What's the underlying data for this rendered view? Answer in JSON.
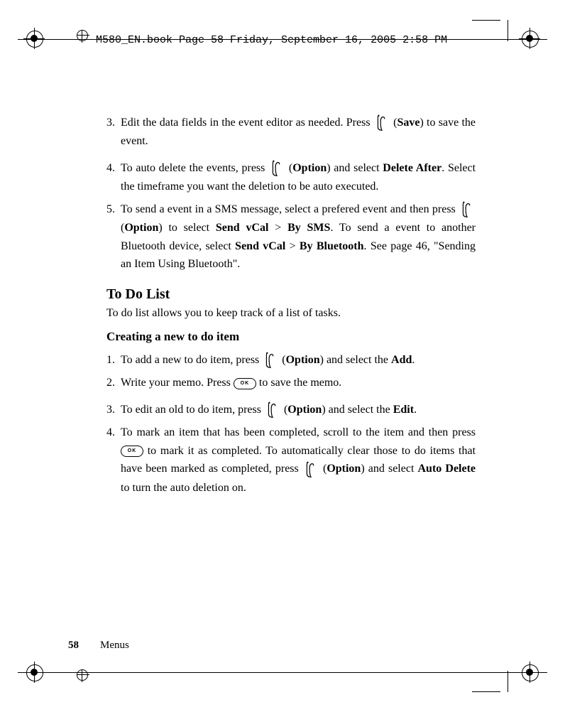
{
  "header": {
    "source_line": "M580_EN.book  Page 58  Friday, September 16, 2005  2:58 PM"
  },
  "list_top": {
    "item3": {
      "num": "3.",
      "t1": "Edit the data fields in the event editor as needed. Press",
      "save": "Save",
      "t2": ") to save the event."
    },
    "item4": {
      "num": "4.",
      "t1": "To auto delete the events, press",
      "option": "Option",
      "t2": ") and select ",
      "bold1": "Delete After",
      "t3": ". Select the timeframe you want the deletion to be auto executed."
    },
    "item5": {
      "num": "5.",
      "t1": "To send a event in a SMS message, select a prefered event and then press",
      "option": "Option",
      "t2": ") to select ",
      "bold1": "Send vCal",
      "gt1": " > ",
      "bold2": "By SMS",
      "t3": ". To send a event to another Bluetooth device, select  ",
      "bold3": "Send vCal",
      "gt2": " > ",
      "bold4": "By Bluetooth",
      "t4": ". See page 46, \"Sending an Item Using Bluetooth\"."
    }
  },
  "todo": {
    "heading": "To Do List",
    "desc": "To do list allows you to keep track of a list of tasks.",
    "sub": "Creating a new to do item",
    "item1": {
      "num": "1.",
      "t1": "To add a new to do item, press",
      "option": "Option",
      "t2": ") and select the ",
      "bold1": "Add",
      "t3": "."
    },
    "item2": {
      "num": "2.",
      "t1": "Write your memo. Press",
      "t2": " to save the memo."
    },
    "item3": {
      "num": "3.",
      "t1": "To edit an old to do item, press",
      "option": "Option",
      "t2": ") and select the ",
      "bold1": "Edit",
      "t3": "."
    },
    "item4": {
      "num": "4.",
      "t1": "To mark an item that has been completed, scroll to the item and then press",
      "t2": " to mark it as completed. To automatically clear those to do items that have been marked as completed, press",
      "option": "Option",
      "t3": ") and select ",
      "bold1": "Auto Delete",
      "t4": " to turn the auto deletion on."
    }
  },
  "footer": {
    "pagenum": "58",
    "section": "Menus"
  },
  "icons": {
    "ok": "OK"
  }
}
